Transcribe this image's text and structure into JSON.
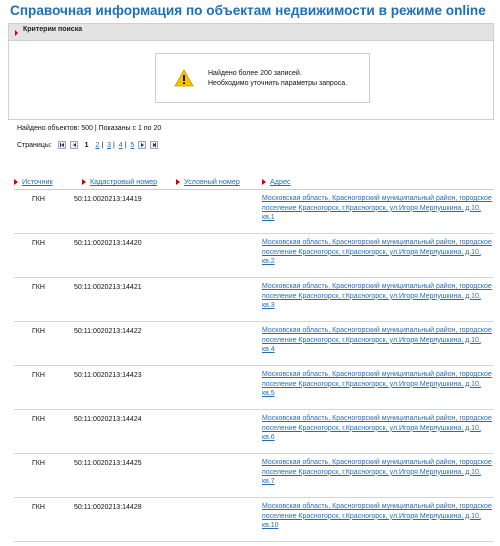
{
  "page_title": "Справочная информация по объектам недвижимости в режиме online",
  "criteria_panel": {
    "label": "Критерии поиска",
    "warning_line1": "Найдено более 200 записей.",
    "warning_line2": "Необходимо уточнить параметры запроса."
  },
  "found_text": "Найдено объектов: 500 | Показаны с 1 по 20",
  "pagination": {
    "label": "Страницы:",
    "current": "1",
    "pages": [
      "2",
      "3",
      "4",
      "5"
    ],
    "icons": [
      "first-page-icon",
      "prev-page-icon",
      "next-page-icon",
      "last-page-icon"
    ]
  },
  "table": {
    "headers": [
      "Источник",
      "Кадастровый номер",
      "Условный номер",
      "Адрес"
    ],
    "rows": [
      {
        "source": "ГКН",
        "cadastral": "50:11:0020213:14419",
        "address": "Московская область, Красногорский муниципальный район, городское поселение Красногорск, г.Красногорск, ул.Игоря Мерлушкина, д.10, кв.1"
      },
      {
        "source": "ГКН",
        "cadastral": "50:11:0020213:14420",
        "address": "Московская область, Красногорский муниципальный район, городское поселение Красногорск, г.Красногорск, ул.Игоря Мерлушкина, д.10, кв.2"
      },
      {
        "source": "ГКН",
        "cadastral": "50:11:0020213:14421",
        "address": "Московская область, Красногорский муниципальный район, городское поселение Красногорск, г.Красногорск, ул.Игоря Мерлушкина, д.10, кв.3"
      },
      {
        "source": "ГКН",
        "cadastral": "50:11:0020213:14422",
        "address": "Московская область, Красногорский муниципальный район, городское поселение Красногорск, г.Красногорск, ул.Игоря Мерлушкина, д.10, кв.4"
      },
      {
        "source": "ГКН",
        "cadastral": "50:11:0020213:14423",
        "address": "Московская область, Красногорский муниципальный район, городское поселение Красногорск, г.Красногорск, ул.Игоря Мерлушкина, д.10, кв.5"
      },
      {
        "source": "ГКН",
        "cadastral": "50:11:0020213:14424",
        "address": "Московская область, Красногорский муниципальный район, городское поселение Красногорск, г.Красногорск, ул.Игоря Мерлушкина, д.10, кв.6"
      },
      {
        "source": "ГКН",
        "cadastral": "50:11:0020213:14425",
        "address": "Московская область, Красногорский муниципальный район, городское поселение Красногорск, г.Красногорск, ул.Игоря Мерлушкина, д.10, кв.7"
      },
      {
        "source": "ГКН",
        "cadastral": "50:11:0020213:14428",
        "address": "Московская область, Красногорский муниципальный район, городское поселение Красногорск, г.Красногорск, ул.Игоря Мерлушкина, д.10, кв.10"
      }
    ]
  },
  "colors": {
    "title": "#1f6fb6",
    "link": "#1f6fb6",
    "accent": "#cc0000",
    "warning": "#f5c400"
  }
}
